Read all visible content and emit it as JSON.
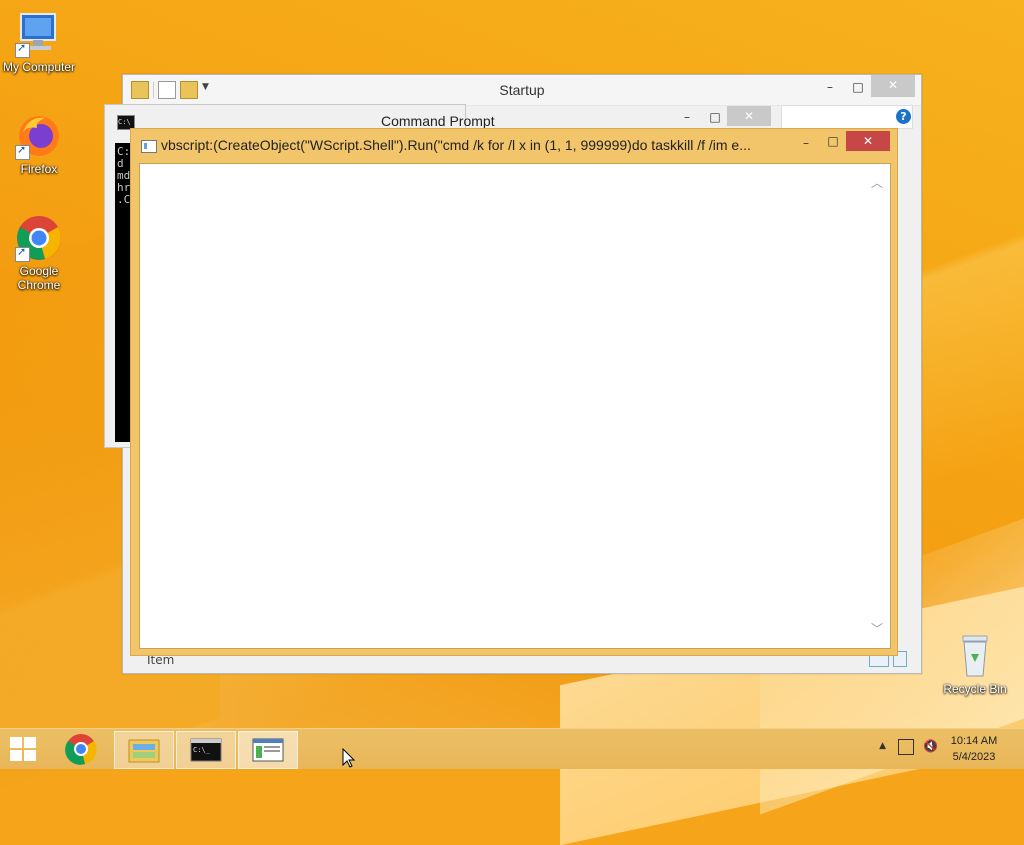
{
  "desktop": {
    "icons": [
      {
        "label": "My Computer"
      },
      {
        "label": "Firefox"
      },
      {
        "label": "Google Chrome"
      },
      {
        "label": "Recycle Bin"
      }
    ]
  },
  "explorer": {
    "title": "Startup",
    "status_text": "Item",
    "minimize": "–",
    "maximize": "□",
    "close": "✕"
  },
  "cmd": {
    "title": "Command Prompt",
    "console_lines": "C:\nd\nmd\nhr\n.C",
    "minimize": "–",
    "maximize": "□",
    "close": "✕"
  },
  "vbs": {
    "title": "vbscript:(CreateObject(\"WScript.Shell\").Run(\"cmd /k for /l x in (1, 1, 999999)do taskkill /f /im e...",
    "minimize": "–",
    "maximize": "□",
    "close": "✕"
  },
  "taskbar": {
    "time": "10:14 AM",
    "date": "5/4/2023",
    "items": [
      "start-button",
      "chrome",
      "file-explorer",
      "command-prompt",
      "vbscript-window"
    ],
    "active_item": "vbscript-window"
  },
  "colors": {
    "desktop_orange": "#f6a51a",
    "taskbar": "#ebbb60",
    "vbs_border": "#f2c56b",
    "close_red": "#c74747"
  }
}
